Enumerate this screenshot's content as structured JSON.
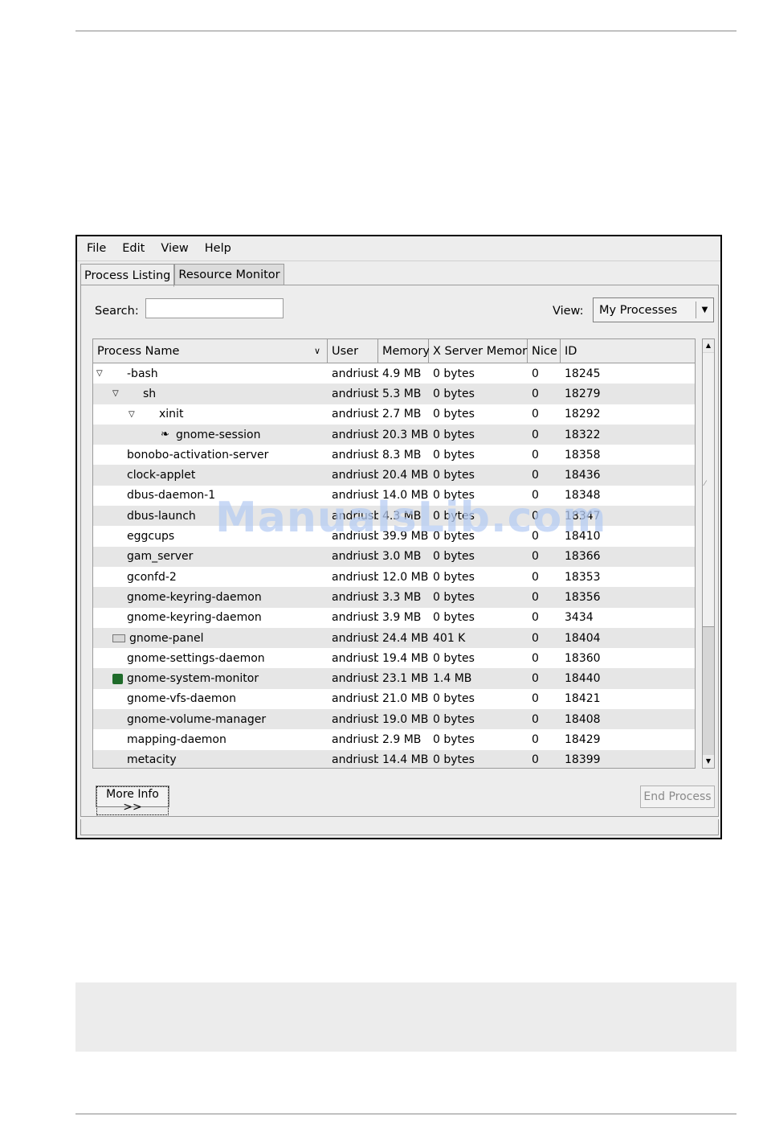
{
  "menubar": {
    "items": [
      "File",
      "Edit",
      "View",
      "Help"
    ]
  },
  "tabs": [
    "Process Listing",
    "Resource Monitor"
  ],
  "search": {
    "label": "Search:",
    "value": ""
  },
  "view": {
    "label": "View:",
    "selected": "My Processes"
  },
  "table": {
    "columns": [
      "Process Name",
      "User",
      "Memory",
      "X Server Memory",
      "Nice",
      "ID"
    ],
    "rows": [
      {
        "name": "-bash",
        "depth": 0,
        "expander": true,
        "icon": "",
        "user": "andriusb",
        "memory": "4.9 MB",
        "xmem": "0 bytes",
        "nice": "0",
        "id": "18245"
      },
      {
        "name": "sh",
        "depth": 1,
        "expander": true,
        "icon": "",
        "user": "andriusb",
        "memory": "5.3 MB",
        "xmem": "0 bytes",
        "nice": "0",
        "id": "18279"
      },
      {
        "name": "xinit",
        "depth": 2,
        "expander": true,
        "icon": "",
        "user": "andriusb",
        "memory": "2.7 MB",
        "xmem": "0 bytes",
        "nice": "0",
        "id": "18292"
      },
      {
        "name": "gnome-session",
        "depth": 3,
        "expander": false,
        "icon": "gnome-foot-icon",
        "user": "andriusb",
        "memory": "20.3 MB",
        "xmem": "0 bytes",
        "nice": "0",
        "id": "18322"
      },
      {
        "name": "bonobo-activation-server",
        "depth": 0,
        "expander": false,
        "icon": "",
        "user": "andriusb",
        "memory": "8.3 MB",
        "xmem": "0 bytes",
        "nice": "0",
        "id": "18358"
      },
      {
        "name": "clock-applet",
        "depth": 0,
        "expander": false,
        "icon": "",
        "user": "andriusb",
        "memory": "20.4 MB",
        "xmem": "0 bytes",
        "nice": "0",
        "id": "18436"
      },
      {
        "name": "dbus-daemon-1",
        "depth": 0,
        "expander": false,
        "icon": "",
        "user": "andriusb",
        "memory": "14.0 MB",
        "xmem": "0 bytes",
        "nice": "0",
        "id": "18348"
      },
      {
        "name": "dbus-launch",
        "depth": 0,
        "expander": false,
        "icon": "",
        "user": "andriusb",
        "memory": "4.3 MB",
        "xmem": "0 bytes",
        "nice": "0",
        "id": "18347"
      },
      {
        "name": "eggcups",
        "depth": 0,
        "expander": false,
        "icon": "",
        "user": "andriusb",
        "memory": "39.9 MB",
        "xmem": "0 bytes",
        "nice": "0",
        "id": "18410"
      },
      {
        "name": "gam_server",
        "depth": 0,
        "expander": false,
        "icon": "",
        "user": "andriusb",
        "memory": "3.0 MB",
        "xmem": "0 bytes",
        "nice": "0",
        "id": "18366"
      },
      {
        "name": "gconfd-2",
        "depth": 0,
        "expander": false,
        "icon": "",
        "user": "andriusb",
        "memory": "12.0 MB",
        "xmem": "0 bytes",
        "nice": "0",
        "id": "18353"
      },
      {
        "name": "gnome-keyring-daemon",
        "depth": 0,
        "expander": false,
        "icon": "",
        "user": "andriusb",
        "memory": "3.3 MB",
        "xmem": "0 bytes",
        "nice": "0",
        "id": "18356"
      },
      {
        "name": "gnome-keyring-daemon",
        "depth": 0,
        "expander": false,
        "icon": "",
        "user": "andriusb",
        "memory": "3.9 MB",
        "xmem": "0 bytes",
        "nice": "0",
        "id": "3434"
      },
      {
        "name": "gnome-panel",
        "depth": 0,
        "expander": false,
        "icon": "panel-icon",
        "user": "andriusb",
        "memory": "24.4 MB",
        "xmem": "401 K",
        "nice": "0",
        "id": "18404"
      },
      {
        "name": "gnome-settings-daemon",
        "depth": 0,
        "expander": false,
        "icon": "",
        "user": "andriusb",
        "memory": "19.4 MB",
        "xmem": "0 bytes",
        "nice": "0",
        "id": "18360"
      },
      {
        "name": "gnome-system-monitor",
        "depth": 0,
        "expander": false,
        "icon": "system-monitor-icon",
        "user": "andriusb",
        "memory": "23.1 MB",
        "xmem": "1.4 MB",
        "nice": "0",
        "id": "18440"
      },
      {
        "name": "gnome-vfs-daemon",
        "depth": 0,
        "expander": false,
        "icon": "",
        "user": "andriusb",
        "memory": "21.0 MB",
        "xmem": "0 bytes",
        "nice": "0",
        "id": "18421"
      },
      {
        "name": "gnome-volume-manager",
        "depth": 0,
        "expander": false,
        "icon": "",
        "user": "andriusb",
        "memory": "19.0 MB",
        "xmem": "0 bytes",
        "nice": "0",
        "id": "18408"
      },
      {
        "name": "mapping-daemon",
        "depth": 0,
        "expander": false,
        "icon": "",
        "user": "andriusb",
        "memory": "2.9 MB",
        "xmem": "0 bytes",
        "nice": "0",
        "id": "18429"
      },
      {
        "name": "metacity",
        "depth": 0,
        "expander": false,
        "icon": "",
        "user": "andriusb",
        "memory": "14.4 MB",
        "xmem": "0 bytes",
        "nice": "0",
        "id": "18399"
      }
    ]
  },
  "buttons": {
    "more_info": "More Info >>",
    "end_process": "End Process"
  },
  "watermark": "ManualsLib.com"
}
